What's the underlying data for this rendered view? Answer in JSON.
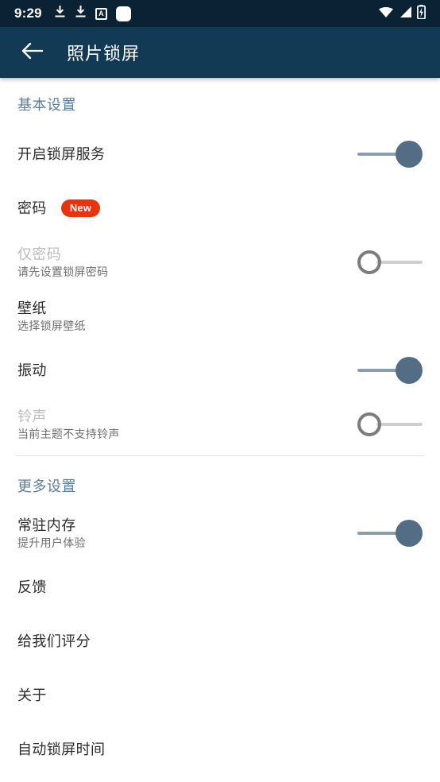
{
  "statusbar": {
    "clock": "9:29",
    "left_icons": [
      "download-icon",
      "download-icon",
      "letter-a-box-icon",
      "rounded-square-icon"
    ],
    "right_icons": [
      "wifi-icon",
      "cellular-signal-icon",
      "battery-charging-icon"
    ],
    "background_color": "#0b2234"
  },
  "appbar": {
    "back_icon": "back-arrow-icon",
    "title": "照片锁屏",
    "background_color": "#123a54",
    "text_color": "#ffffff"
  },
  "colors": {
    "section_header": "#5d7e9b",
    "title": "#2b2b2b",
    "subtitle": "#6e6e6e",
    "disabled_title": "#bcbcbc",
    "badge_background": "#e8340c",
    "switch_on_thumb": "#536d85",
    "switch_on_track": "#8b9cad",
    "switch_off_border": "#7c7c7c",
    "switch_off_track": "#cfcfcf",
    "divider": "#e2e2e2",
    "page_background": "#ffffff"
  },
  "sections": [
    {
      "header": "基本设置",
      "rows": [
        {
          "title": "开启锁屏服务",
          "subtitle": "",
          "badge": "",
          "control": "switch",
          "state": "on",
          "disabled": false
        },
        {
          "title": "密码",
          "subtitle": "",
          "badge": "New",
          "control": "none",
          "state": "",
          "disabled": false
        },
        {
          "title": "仅密码",
          "subtitle": "请先设置锁屏密码",
          "badge": "",
          "control": "switch",
          "state": "off",
          "disabled": true
        },
        {
          "title": "壁纸",
          "subtitle": "选择锁屏壁纸",
          "badge": "",
          "control": "none",
          "state": "",
          "disabled": false
        },
        {
          "title": "振动",
          "subtitle": "",
          "badge": "",
          "control": "switch",
          "state": "on",
          "disabled": false
        },
        {
          "title": "铃声",
          "subtitle": "当前主题不支持铃声",
          "badge": "",
          "control": "switch",
          "state": "off",
          "disabled": true
        }
      ]
    },
    {
      "header": "更多设置",
      "rows": [
        {
          "title": "常驻内存",
          "subtitle": "提升用户体验",
          "badge": "",
          "control": "switch",
          "state": "on",
          "disabled": false
        },
        {
          "title": "反馈",
          "subtitle": "",
          "badge": "",
          "control": "none",
          "state": "",
          "disabled": false
        },
        {
          "title": "给我们评分",
          "subtitle": "",
          "badge": "",
          "control": "none",
          "state": "",
          "disabled": false
        },
        {
          "title": "关于",
          "subtitle": "",
          "badge": "",
          "control": "none",
          "state": "",
          "disabled": false
        },
        {
          "title": "自动锁屏时间",
          "subtitle": "",
          "badge": "",
          "control": "none",
          "state": "",
          "disabled": false
        }
      ]
    }
  ]
}
